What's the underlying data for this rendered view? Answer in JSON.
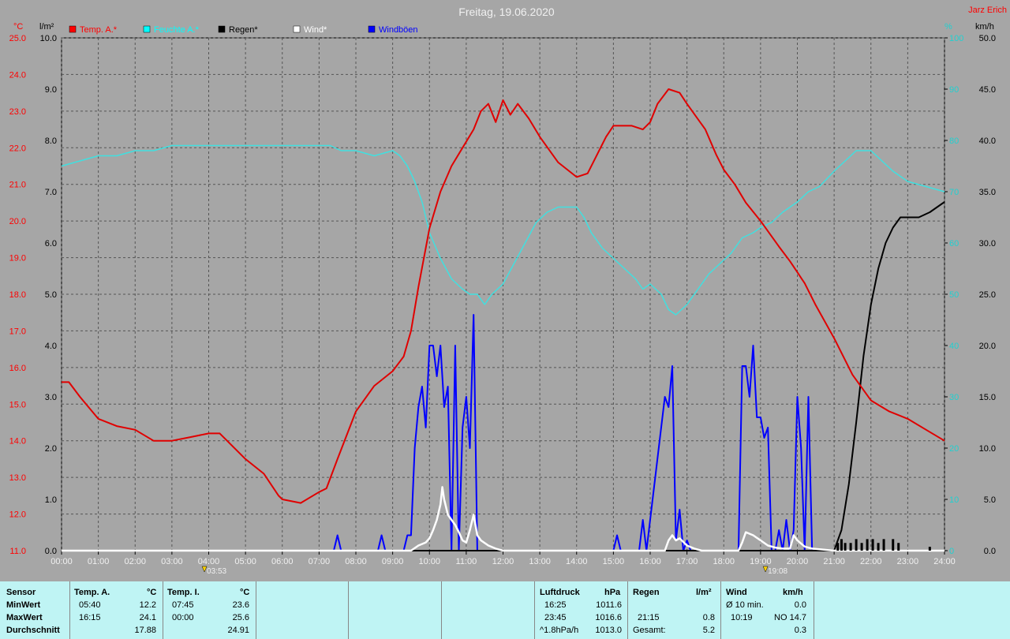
{
  "title": "Freitag, 19.06.2020",
  "author": "Jarz Erich",
  "axis_units": {
    "left_outer": "°C",
    "left_inner": "l/m²",
    "right_inner": "%",
    "right_outer": "km/h"
  },
  "legend": [
    {
      "label": "Temp. A.*",
      "color": "#ff0000"
    },
    {
      "label": "Feuchte A.*",
      "color": "#00ffff"
    },
    {
      "label": "Regen*",
      "color": "#000000"
    },
    {
      "label": "Wind*",
      "color": "#ffffff"
    },
    {
      "label": "Windböen",
      "color": "#0000ff"
    }
  ],
  "colors": {
    "temp": "#e00000",
    "hum": "#40e0e0",
    "rain": "#000000",
    "wind": "#ffffff",
    "gust": "#0000ff",
    "bg": "#a6a6a6",
    "table_bg": "#bff4f4"
  },
  "markers": [
    {
      "time": "03:53",
      "label": "03:53"
    },
    {
      "time": "19:08",
      "label": "19:08"
    }
  ],
  "chart_data": {
    "type": "line",
    "title": "Freitag, 19.06.2020",
    "x_ticks": [
      "00:00",
      "01:00",
      "02:00",
      "03:00",
      "04:00",
      "05:00",
      "06:00",
      "07:00",
      "08:00",
      "09:00",
      "10:00",
      "11:00",
      "12:00",
      "13:00",
      "14:00",
      "15:00",
      "16:00",
      "17:00",
      "18:00",
      "19:00",
      "20:00",
      "21:00",
      "22:00",
      "23:00",
      "24:00"
    ],
    "xlim_hours": [
      0,
      24
    ],
    "axes": {
      "temp_c": {
        "lim": [
          11.0,
          25.0
        ],
        "ticks": [
          "11.0",
          "12.0",
          "13.0",
          "14.0",
          "15.0",
          "16.0",
          "17.0",
          "18.0",
          "19.0",
          "20.0",
          "21.0",
          "22.0",
          "23.0",
          "24.0",
          "25.0"
        ]
      },
      "rain_lm2": {
        "lim": [
          0.0,
          10.0
        ],
        "ticks": [
          "0.0",
          "1.0",
          "2.0",
          "3.0",
          "4.0",
          "5.0",
          "6.0",
          "7.0",
          "8.0",
          "9.0",
          "10.0"
        ]
      },
      "humidity_pct": {
        "lim": [
          0,
          100
        ],
        "ticks": [
          "0",
          "10",
          "20",
          "30",
          "40",
          "50",
          "60",
          "70",
          "80",
          "90",
          "100"
        ]
      },
      "wind_kmh": {
        "lim": [
          0.0,
          50.0
        ],
        "ticks": [
          "0.0",
          "5.0",
          "10.0",
          "15.0",
          "20.0",
          "25.0",
          "30.0",
          "35.0",
          "40.0",
          "45.0",
          "50.0"
        ]
      }
    },
    "grid": true,
    "series": [
      {
        "name": "Temp. A.*",
        "axis": "temp_c",
        "x": [
          0,
          0.2,
          0.5,
          1,
          1.5,
          2,
          2.5,
          3,
          3.5,
          4,
          4.3,
          4.5,
          5,
          5.5,
          5.9,
          6,
          6.5,
          7,
          7.2,
          7.5,
          8,
          8.5,
          9,
          9.3,
          9.5,
          9.7,
          10,
          10.3,
          10.6,
          10.9,
          11.2,
          11.4,
          11.6,
          11.8,
          12,
          12.2,
          12.4,
          12.7,
          13,
          13.5,
          14,
          14.3,
          14.5,
          14.8,
          15,
          15.5,
          15.8,
          16,
          16.2,
          16.5,
          16.8,
          17,
          17.5,
          17.8,
          18,
          18.3,
          18.6,
          19,
          19.5,
          19.8,
          20,
          20.2,
          20.5,
          21,
          21.5,
          22,
          22.5,
          23,
          23.5,
          24
        ],
        "y": [
          15.6,
          15.6,
          15.2,
          14.6,
          14.4,
          14.3,
          14.0,
          14.0,
          14.1,
          14.2,
          14.2,
          14.0,
          13.5,
          13.1,
          12.5,
          12.4,
          12.3,
          12.6,
          12.7,
          13.5,
          14.8,
          15.5,
          15.9,
          16.3,
          17.0,
          18.2,
          19.8,
          20.8,
          21.5,
          22.0,
          22.5,
          23.0,
          23.2,
          22.7,
          23.3,
          22.9,
          23.2,
          22.8,
          22.3,
          21.6,
          21.2,
          21.3,
          21.7,
          22.3,
          22.6,
          22.6,
          22.5,
          22.7,
          23.2,
          23.6,
          23.5,
          23.2,
          22.5,
          21.8,
          21.4,
          21.0,
          20.5,
          20.0,
          19.3,
          18.9,
          18.6,
          18.3,
          17.7,
          16.8,
          15.8,
          15.1,
          14.8,
          14.6,
          14.3,
          14.0
        ]
      },
      {
        "name": "Feuchte A.*",
        "axis": "humidity_pct",
        "x": [
          0,
          0.5,
          1,
          1.5,
          2,
          2.5,
          3,
          3.5,
          4,
          4.5,
          5,
          5.5,
          6,
          6.5,
          7,
          7.3,
          7.6,
          8,
          8.5,
          9,
          9.2,
          9.4,
          9.6,
          9.8,
          10,
          10.3,
          10.6,
          10.9,
          11.1,
          11.3,
          11.5,
          11.7,
          12,
          12.3,
          12.6,
          12.9,
          13.2,
          13.5,
          13.8,
          14,
          14.2,
          14.4,
          14.7,
          15,
          15.3,
          15.6,
          15.8,
          16,
          16.3,
          16.5,
          16.7,
          17,
          17.3,
          17.6,
          17.9,
          18.2,
          18.5,
          18.8,
          19,
          19.3,
          19.6,
          20,
          20.3,
          20.6,
          21,
          21.3,
          21.6,
          22,
          22.3,
          22.6,
          23,
          23.5,
          24
        ],
        "y": [
          75,
          76,
          77,
          77,
          78,
          78,
          79,
          79,
          79,
          79,
          79,
          79,
          79,
          79,
          79,
          79,
          78,
          78,
          77,
          78,
          77,
          75,
          72,
          68,
          62,
          57,
          53,
          51,
          50,
          50,
          48,
          50,
          52,
          56,
          60,
          64,
          66,
          67,
          67,
          67,
          65,
          62,
          59,
          57,
          55,
          53,
          51,
          52,
          50,
          47,
          46,
          48,
          51,
          54,
          56,
          58,
          61,
          62,
          63,
          64,
          66,
          68,
          70,
          71,
          74,
          76,
          78,
          78,
          76,
          74,
          72,
          71,
          70
        ]
      },
      {
        "name": "Regen*",
        "axis": "rain_lm2",
        "x": [
          0,
          21.0,
          21.2,
          21.4,
          21.6,
          21.8,
          22.0,
          22.2,
          22.4,
          22.6,
          22.8,
          23.0,
          23.3,
          23.6,
          23.8,
          24
        ],
        "y": [
          0,
          0.0,
          0.4,
          1.3,
          2.5,
          3.8,
          4.8,
          5.5,
          6.0,
          6.3,
          6.5,
          6.5,
          6.5,
          6.6,
          6.7,
          6.8
        ]
      },
      {
        "name": "Wind*",
        "axis": "wind_kmh",
        "x": [
          0,
          9.5,
          9.7,
          9.9,
          10.0,
          10.1,
          10.2,
          10.3,
          10.35,
          10.4,
          10.5,
          10.6,
          10.7,
          10.8,
          10.9,
          11.0,
          11.1,
          11.2,
          11.3,
          11.4,
          11.6,
          11.8,
          12.0,
          16.4,
          16.5,
          16.6,
          16.7,
          16.8,
          17.0,
          17.2,
          17.4,
          18.4,
          18.5,
          18.6,
          18.8,
          19.0,
          19.2,
          19.4,
          19.6,
          19.8,
          19.9,
          20.0,
          20.2,
          20.4,
          21.0,
          24
        ],
        "y": [
          0,
          0,
          0.5,
          0.8,
          1.2,
          2.0,
          3.0,
          4.5,
          6.2,
          5.0,
          3.5,
          3.0,
          2.5,
          1.8,
          1.0,
          0.8,
          2.0,
          3.5,
          1.5,
          1.0,
          0.5,
          0.2,
          0,
          0,
          1.0,
          1.5,
          1.0,
          1.2,
          0.5,
          0.2,
          0,
          0,
          0.8,
          1.8,
          1.5,
          1.0,
          0.5,
          0.3,
          0.2,
          0.2,
          1.5,
          1.0,
          0.4,
          0.2,
          0,
          0
        ]
      },
      {
        "name": "Windböen",
        "axis": "wind_kmh",
        "x": [
          0,
          7.4,
          7.5,
          7.6,
          8.6,
          8.7,
          8.8,
          9.3,
          9.4,
          9.5,
          9.6,
          9.7,
          9.8,
          9.9,
          10.0,
          10.1,
          10.2,
          10.3,
          10.4,
          10.5,
          10.6,
          10.7,
          10.8,
          10.9,
          11.0,
          11.1,
          11.2,
          11.3,
          11.4,
          15.0,
          15.1,
          15.2,
          15.7,
          15.8,
          15.9,
          16.4,
          16.5,
          16.6,
          16.7,
          16.8,
          16.9,
          17.0,
          17.1,
          17.2,
          18.4,
          18.5,
          18.6,
          18.7,
          18.8,
          18.9,
          19.0,
          19.1,
          19.2,
          19.3,
          19.4,
          19.5,
          19.6,
          19.7,
          19.8,
          19.9,
          20.0,
          20.1,
          20.2,
          20.3,
          20.4,
          24
        ],
        "y": [
          0,
          0,
          1.5,
          0,
          0,
          1.5,
          0,
          0,
          1.5,
          1.5,
          10,
          14,
          16,
          12,
          20,
          20,
          17,
          20,
          14,
          16,
          0,
          20,
          0,
          12,
          15,
          10,
          23,
          0,
          0,
          0,
          1.5,
          0,
          0,
          3,
          0,
          15,
          14,
          18,
          1,
          4,
          0,
          1,
          0,
          0,
          0,
          18,
          18,
          15,
          20,
          13,
          13,
          11,
          12,
          0,
          0,
          2,
          0,
          3,
          0,
          2,
          15,
          10,
          0,
          15,
          0,
          0
        ]
      }
    ]
  },
  "table": {
    "rows": [
      "Sensor",
      "MinWert",
      "MaxWert",
      "Durchschnitt"
    ],
    "groups": [
      {
        "title": "Temp. A.",
        "unit": "°C",
        "min_time": "05:40",
        "min_val": "12.2",
        "max_time": "16:15",
        "max_val": "24.1",
        "avg": "17.88"
      },
      {
        "title": "Temp. I.",
        "unit": "°C",
        "min_time": "07:45",
        "min_val": "23.6",
        "max_time": "00:00",
        "max_val": "25.6",
        "avg": "24.91"
      },
      {
        "title": "Luftdruck",
        "unit": "hPa",
        "min_time": "16:25",
        "min_val": "1011.6",
        "max_time": "23:45",
        "max_val": "1016.6",
        "avg_label": "^1.8hPa/h",
        "avg": "1013.0"
      },
      {
        "title": "Regen",
        "unit": "l/m²",
        "min_time": "",
        "min_val": "",
        "max_time": "21:15",
        "max_val": "0.8",
        "avg_label": "Gesamt:",
        "avg": "5.2"
      },
      {
        "title": "Wind",
        "unit": "km/h",
        "min_time": "Ø 10 min.",
        "min_val": "0.0",
        "max_time": "10:19",
        "max_val": "NO 14.7",
        "avg": "0.3"
      }
    ]
  }
}
